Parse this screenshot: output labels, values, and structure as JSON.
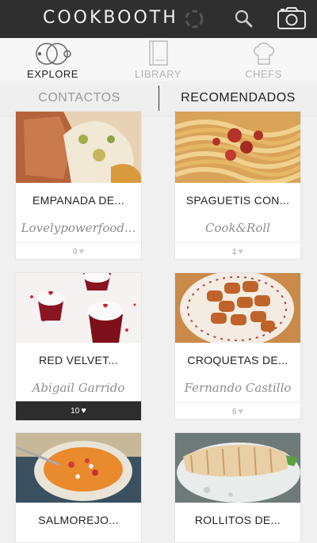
{
  "header": {
    "logo": "COOKBOOTH"
  },
  "tabs": [
    {
      "label": "EXPLORE",
      "color": "#222222"
    },
    {
      "label": "LIBRARY",
      "color": "#b5b5b5"
    },
    {
      "label": "CHEFS",
      "color": "#b5b5b5"
    }
  ],
  "segments": {
    "left": {
      "label": "CONTACTOS",
      "color": "#9a9a9a"
    },
    "right": {
      "label": "RECOMENDADOS",
      "color": "#222222"
    }
  },
  "cards": [
    {
      "title": "EMPANADA DE...",
      "author": "Lovelypowerfood...",
      "likes": "0",
      "highlight": false
    },
    {
      "title": "SPAGUETIS CON...",
      "author": "Cook&Roll",
      "likes": "1",
      "highlight": false
    },
    {
      "title": "RED VELVET...",
      "author": "Abigail Garrido",
      "likes": "10",
      "highlight": true
    },
    {
      "title": "CROQUETAS DE...",
      "author": "Fernando Castillo",
      "likes": "6",
      "highlight": false
    },
    {
      "title": "SALMOREJO...",
      "author": "",
      "likes": "",
      "highlight": false
    },
    {
      "title": "ROLLITOS DE...",
      "author": "",
      "likes": "",
      "highlight": false
    }
  ],
  "icons": {
    "sync": "sync-icon",
    "search": "search-icon",
    "camera": "camera-icon",
    "explore": "explore-icon",
    "library": "library-icon",
    "chefs": "chef-hat-icon",
    "heart": "heart-icon"
  },
  "colors": {
    "topbar": "#2f2f2f",
    "accent_dark": "#2d2d2d"
  }
}
